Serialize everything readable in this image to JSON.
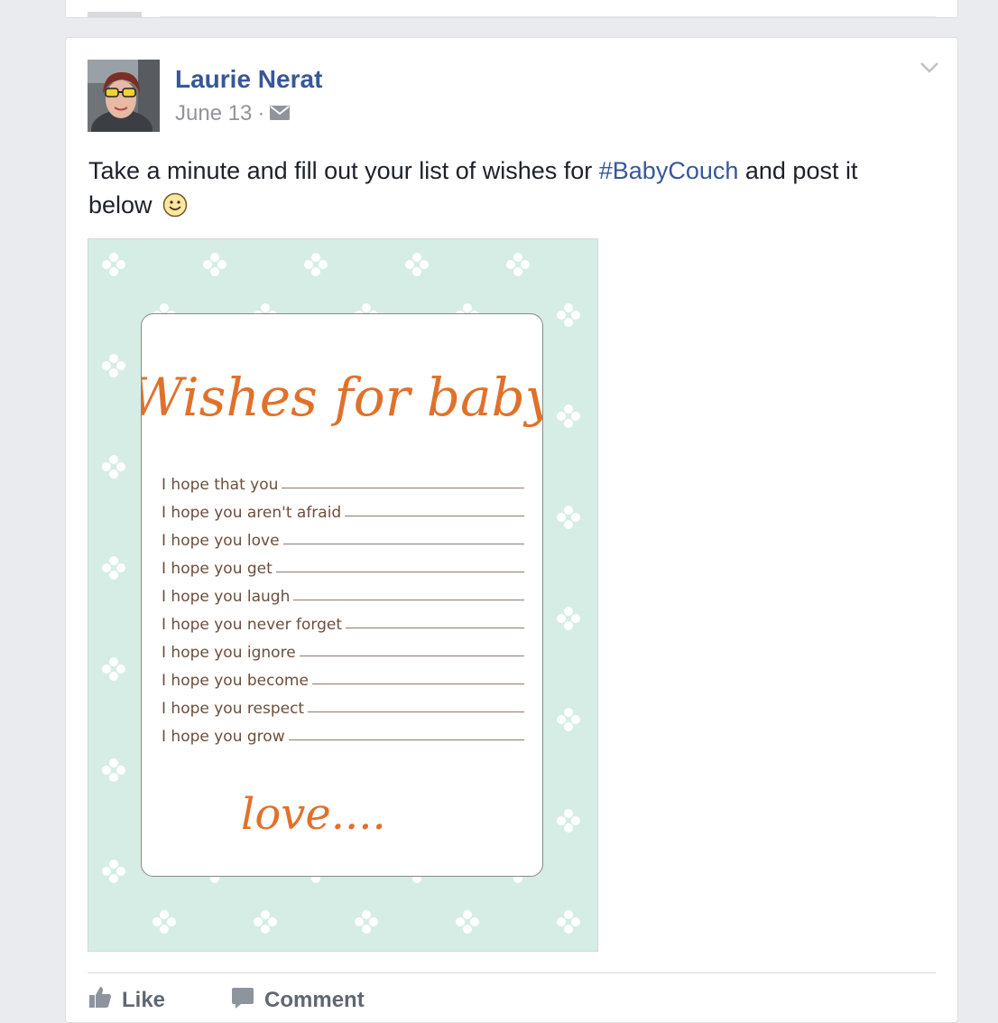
{
  "post": {
    "author": "Laurie Nerat",
    "date": "June 13",
    "separator": "·",
    "privacy_icon": "envelope-icon",
    "text_before": "Take a minute and fill out your list of wishes for ",
    "hashtag": "#BabyCouch",
    "text_after": " and post it below",
    "emoji": "smiley-icon"
  },
  "image": {
    "title": "Wishes for baby",
    "lines": [
      "I hope that you",
      "I hope you aren't afraid",
      "I hope you love",
      "I hope you get",
      "I hope you laugh",
      "I hope you never forget",
      "I hope you ignore",
      "I hope you become",
      "I hope you respect",
      "I hope you grow"
    ],
    "signoff": "love....",
    "colors": {
      "background": "#d6ede6",
      "accent": "#e0712b",
      "text": "#6b4e3d"
    }
  },
  "actions": {
    "like": "Like",
    "comment": "Comment"
  },
  "colors": {
    "link": "#365899",
    "page_bg": "#e9ebee"
  }
}
